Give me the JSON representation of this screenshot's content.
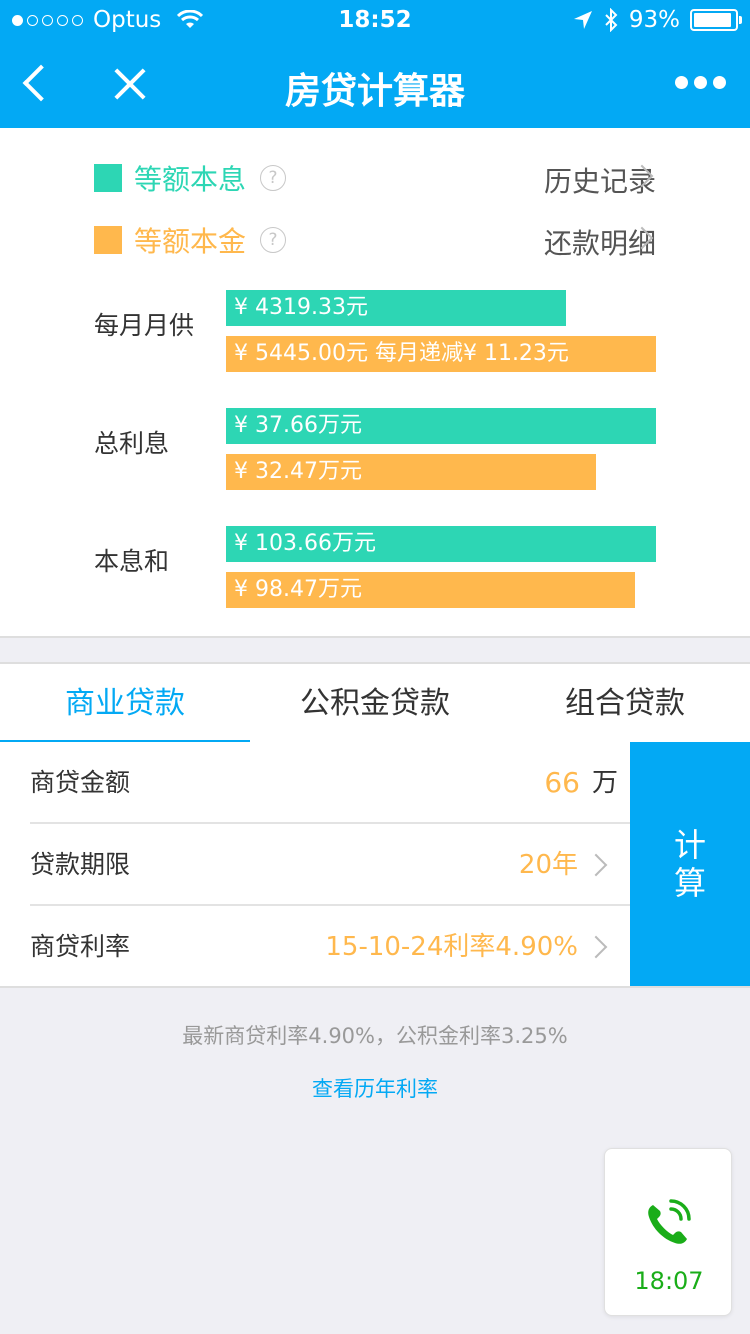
{
  "status_bar": {
    "carrier": "Optus",
    "time": "18:52",
    "battery": "93%",
    "battery_level": 0.93,
    "icons": [
      "signal-dots-icon",
      "wifi-icon",
      "location-arrow-icon",
      "bluetooth-icon",
      "battery-icon"
    ]
  },
  "nav": {
    "title": "房贷计算器",
    "icons": [
      "back-chevron-icon",
      "close-icon",
      "more-dots-icon"
    ]
  },
  "colors": {
    "brand": "#03a9f4",
    "green": "#2dd6b4",
    "orange": "#ffb84d",
    "call_green": "#1aad19"
  },
  "legend": [
    {
      "label": "等额本息",
      "help": "?",
      "color": "#2dd6b4",
      "link": "历史记录"
    },
    {
      "label": "等额本金",
      "help": "?",
      "color": "#ffb84d",
      "link": "还款明细"
    }
  ],
  "results": {
    "monthly": {
      "label": "每月月供",
      "green_text": "¥ 4319.33元",
      "green_fraction": 0.79,
      "orange_text": "¥ 5445.00元 每月递减¥ 11.23元",
      "orange_fraction": 1.0
    },
    "interest": {
      "label": "总利息",
      "green_text": "¥ 37.66万元",
      "green_fraction": 1.0,
      "orange_text": "¥ 32.47万元",
      "orange_fraction": 0.86
    },
    "total": {
      "label": "本息和",
      "green_text": "¥ 103.66万元",
      "green_fraction": 1.0,
      "orange_text": "¥ 98.47万元",
      "orange_fraction": 0.95
    }
  },
  "tabs": [
    {
      "label": "商业贷款",
      "active": true
    },
    {
      "label": "公积金贷款"
    },
    {
      "label": "组合贷款"
    }
  ],
  "form": {
    "amount": {
      "label": "商贷金额",
      "value": "66",
      "unit": "万"
    },
    "term": {
      "label": "贷款期限",
      "value": "20年"
    },
    "rate": {
      "label": "商贷利率",
      "value": "15-10-24利率4.90%"
    },
    "calc_button": {
      "line1": "计",
      "line2": "算"
    }
  },
  "rate_info": "最新商贷利率4.90%，公积金利率3.25%",
  "rate_link": "查看历年利率",
  "call_widget": {
    "time": "18:07",
    "icon": "phone-call-icon"
  }
}
